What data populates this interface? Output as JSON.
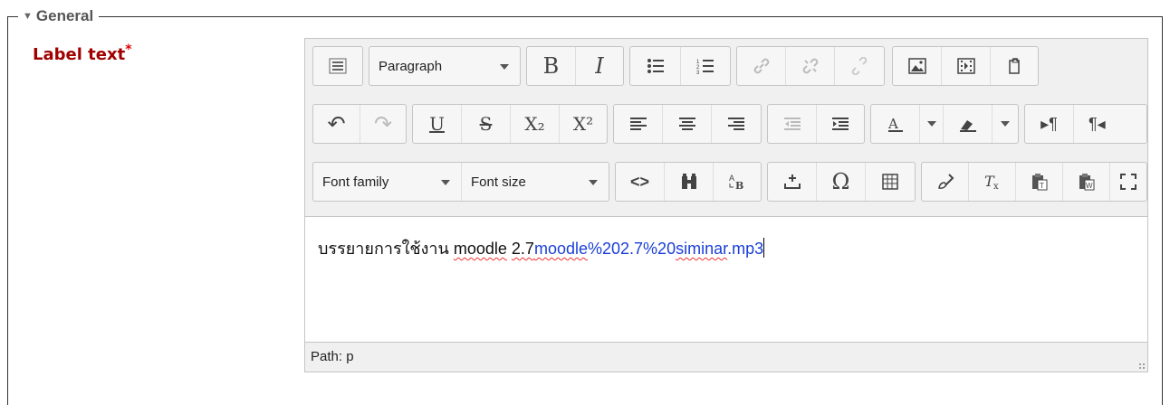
{
  "fieldset": {
    "legend": "General"
  },
  "field": {
    "label": "Label text",
    "required_mark": "*"
  },
  "editor": {
    "row1": {
      "toolbar_toggle_icon": "toolbar-toggle-icon",
      "paragraph_select": "Paragraph",
      "bold": "B",
      "italic": "I",
      "unordered_list_icon": "bullet-list-icon",
      "ordered_list_icon": "numbered-list-icon",
      "link_icon": "link-icon",
      "unlink_icon": "unlink-icon",
      "anchor_icon": "anchor-icon",
      "image_icon": "image-icon",
      "media_icon": "media-icon",
      "files_icon": "manage-files-icon"
    },
    "row2": {
      "undo": "↶",
      "redo": "↷",
      "underline": "U",
      "strikethrough": "S",
      "subscript": "X₂",
      "superscript": "X²",
      "outdent_icon": "outdent-icon",
      "indent_icon": "indent-icon",
      "ltr": "▸¶",
      "rtl": "¶◂"
    },
    "row3": {
      "font_family": "Font family",
      "font_size": "Font size",
      "code": "<>",
      "find_icon": "find-replace-icon",
      "charmap_special": "Ω",
      "equation_icon": "equation-icon"
    },
    "content": {
      "text_plain": "บรรยายการใช้งาน ",
      "text_misspelled": "moodle",
      "text_space": " ",
      "text_version": "2.7",
      "link_a": "moodle",
      "link_b": "%202.7%20",
      "link_c": "siminar",
      "link_d": ".mp3"
    },
    "statusbar": {
      "path": "Path: p"
    }
  },
  "colors": {
    "label": "#a00000",
    "link": "#1a3fd8",
    "spellcheck": "#e33"
  }
}
